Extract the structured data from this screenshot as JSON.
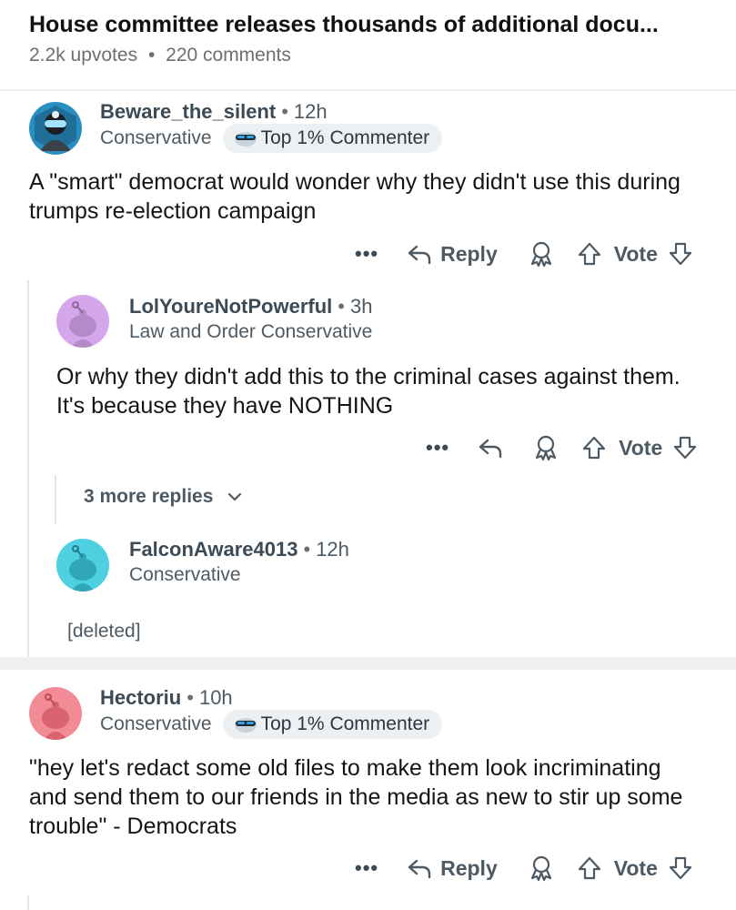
{
  "post": {
    "title": "House committee releases thousands of additional docu...",
    "upvotes": "2.2k upvotes",
    "separator": "•",
    "comments": "220 comments"
  },
  "comments": [
    {
      "author": "Beware_the_silent",
      "age": "12h",
      "flair": "Conservative",
      "badge": "Top 1% Commenter",
      "body": "A \"smart\" democrat would wonder why they didn't use this during trumps re-election campaign",
      "actions": {
        "more": "•••",
        "reply": "Reply",
        "vote": "Vote"
      }
    },
    {
      "author": "LolYoureNotPowerful",
      "age": "3h",
      "flair": "Law and Order Conservative",
      "body": "Or why they didn't add this to the criminal cases against them. It's because they have NOTHING",
      "actions": {
        "more": "•••",
        "vote": "Vote"
      }
    },
    {
      "author": "FalconAware4013",
      "age": "12h",
      "flair": "Conservative",
      "body": "[deleted]"
    },
    {
      "author": "Hectoriu",
      "age": "10h",
      "flair": "Conservative",
      "badge": "Top 1% Commenter",
      "body": "\"hey let's redact some old files to make them look incriminating and send them to our friends in the media as new to stir up some trouble\" - Democrats",
      "actions": {
        "more": "•••",
        "reply": "Reply",
        "vote": "Vote"
      }
    }
  ],
  "more_replies": "3 more replies",
  "colors": {
    "avatar_1_bg": "#2a8fc0",
    "avatar_2_bg": "#d6a6ec",
    "avatar_3_bg": "#4fd0e0",
    "avatar_4_bg": "#f28b96",
    "text_muted": "#4e5a63"
  }
}
